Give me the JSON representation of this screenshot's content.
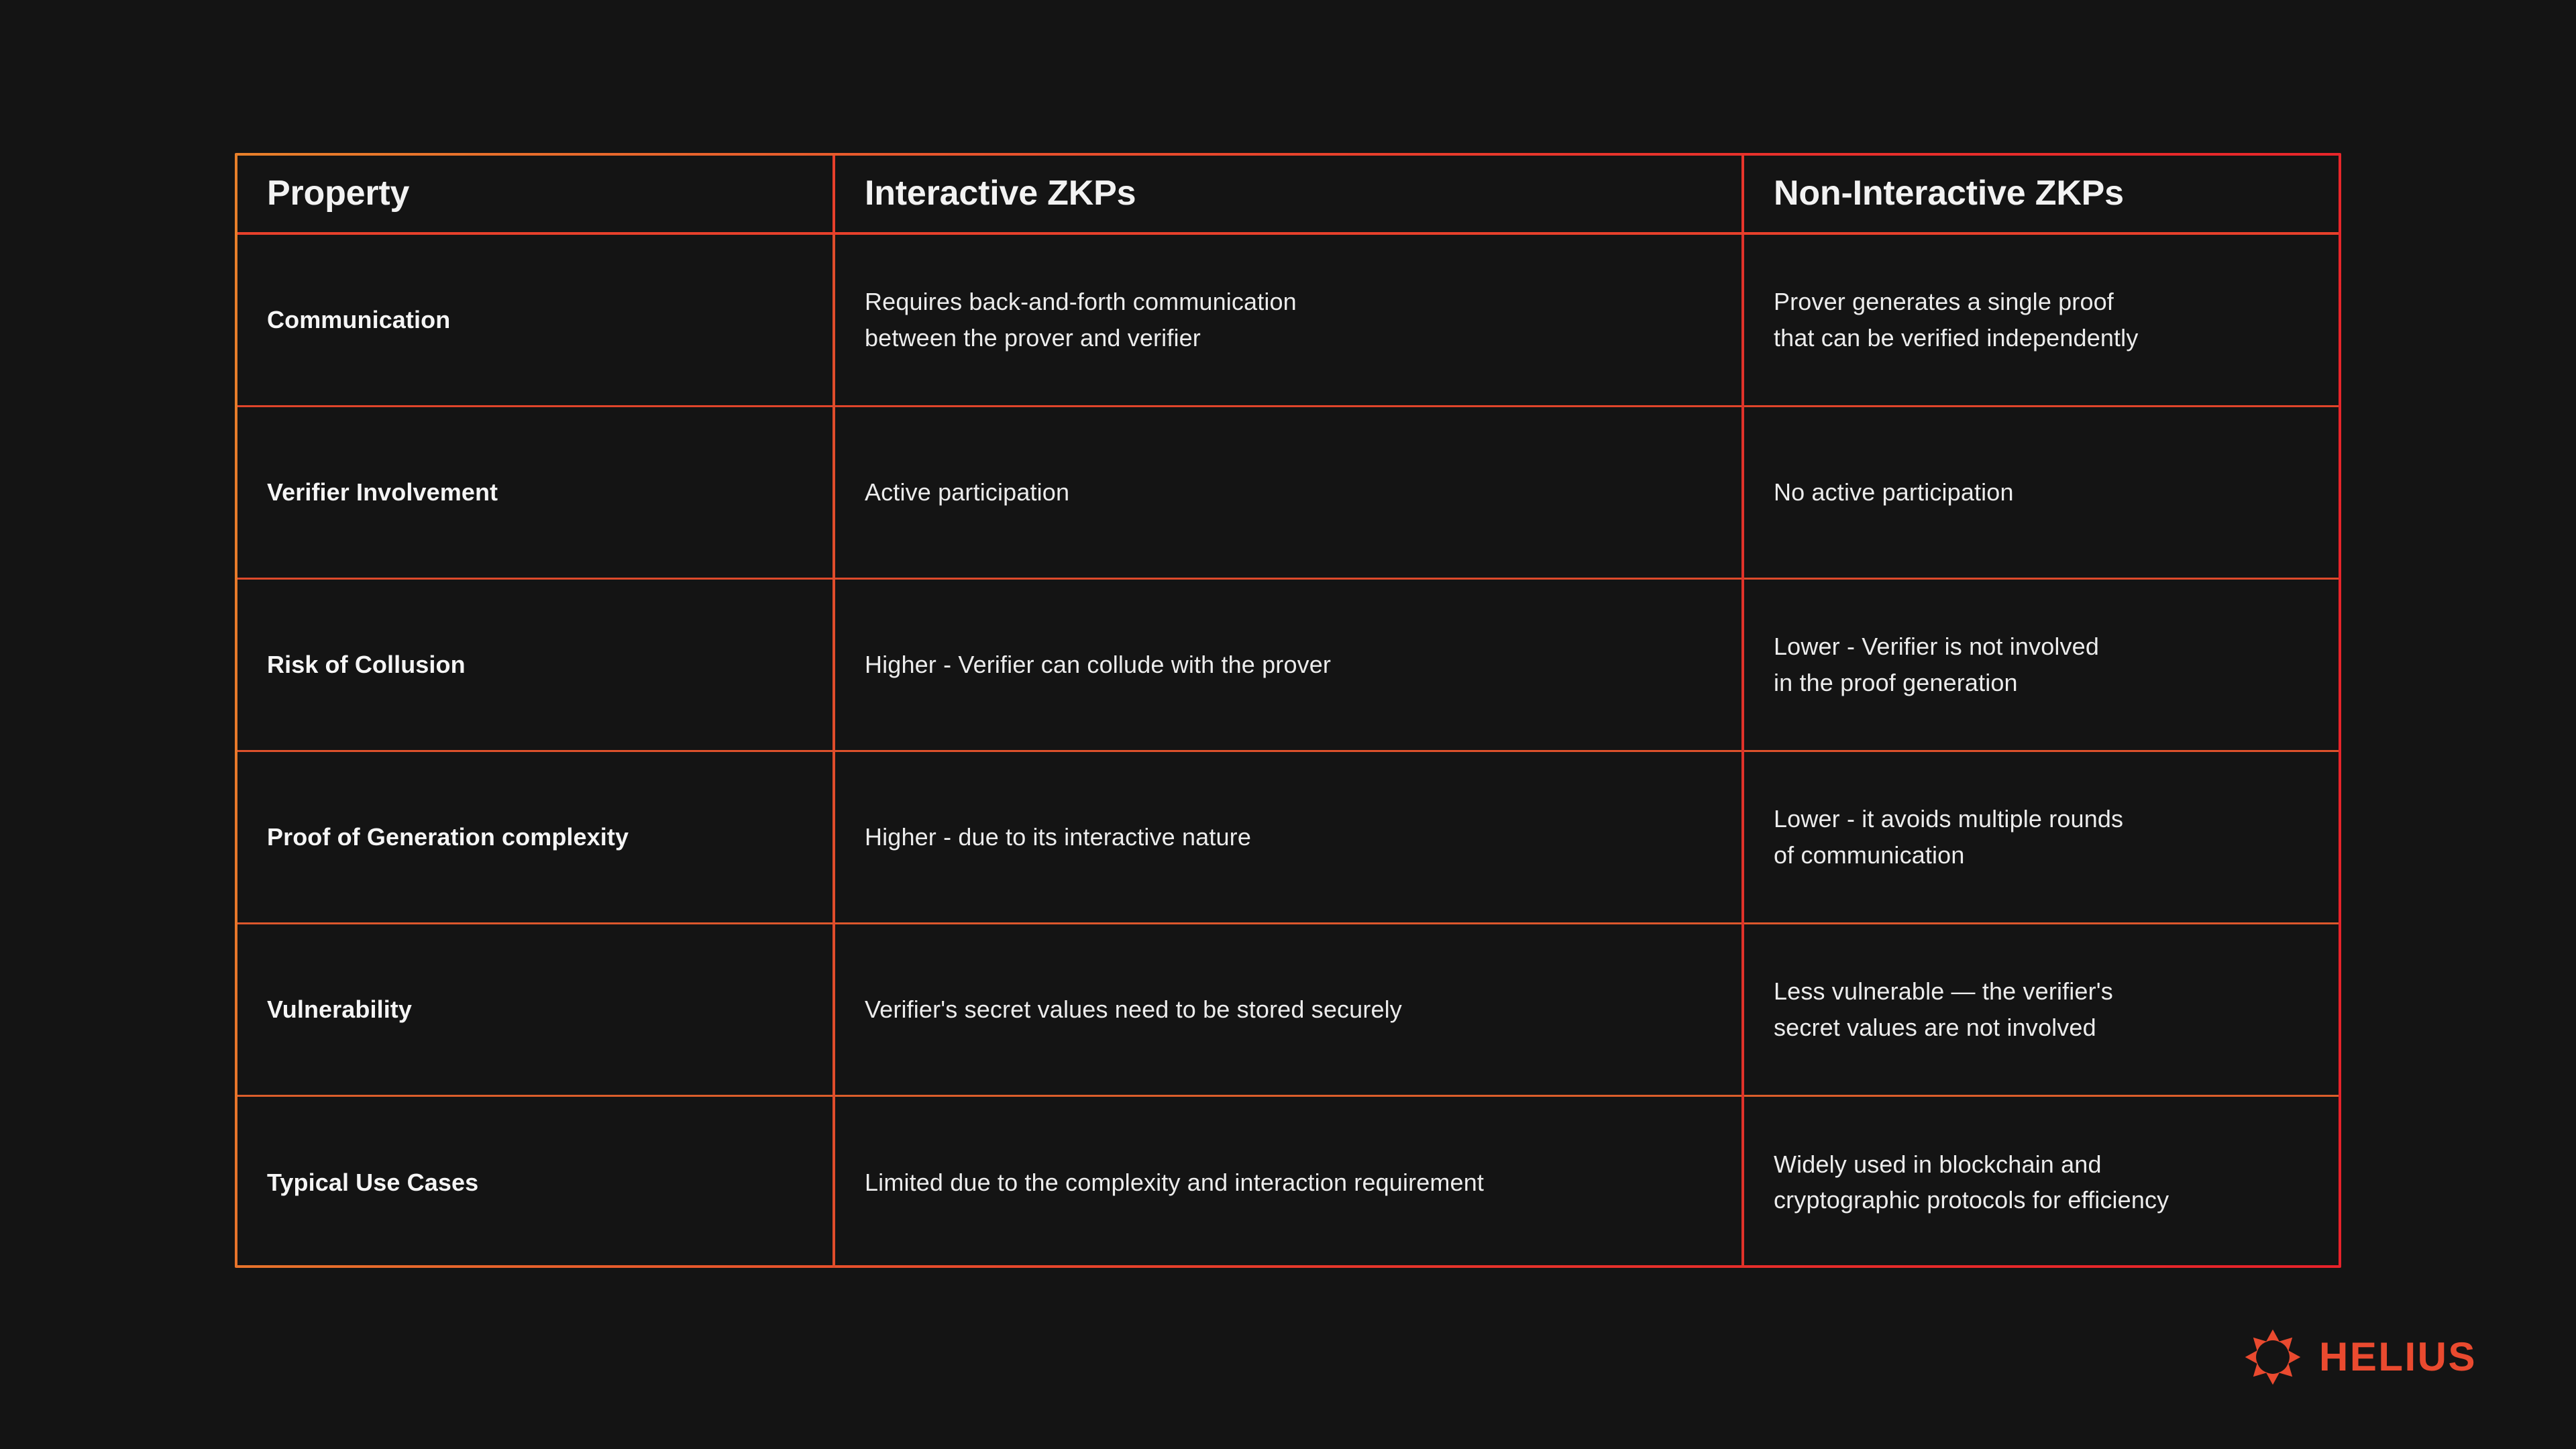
{
  "theme": {
    "background": "#141414",
    "border_gradient_start": "#E8802A",
    "border_gradient_end": "#E8222A",
    "text_color": "#ECECEC",
    "brand_color": "#EA4A2F"
  },
  "table": {
    "headers": [
      "Property",
      "Interactive ZKPs",
      "Non-Interactive ZKPs"
    ],
    "rows": [
      {
        "property": "Communication",
        "interactive": "Requires back-and-forth communication\nbetween the prover and verifier",
        "non_interactive": "Prover generates a single proof\nthat can be verified independently"
      },
      {
        "property": "Verifier Involvement",
        "interactive": "Active participation",
        "non_interactive": "No active participation"
      },
      {
        "property": "Risk of Collusion",
        "interactive": "Higher - Verifier can collude with the prover",
        "non_interactive": "Lower - Verifier is not involved\nin the proof generation"
      },
      {
        "property": "Proof of Generation complexity",
        "interactive": "Higher - due to its interactive nature",
        "non_interactive": "Lower - it avoids multiple rounds\nof communication"
      },
      {
        "property": "Vulnerability",
        "interactive": "Verifier's secret values need to be stored securely",
        "non_interactive": "Less vulnerable — the verifier's\nsecret values are not involved"
      },
      {
        "property": "Typical Use Cases",
        "interactive": "Limited due to the complexity and interaction requirement",
        "non_interactive": "Widely used in blockchain and\ncryptographic protocols for efficiency"
      }
    ]
  },
  "branding": {
    "wordmark": "HELIUS",
    "mark_icon": "sun-burst-icon"
  }
}
